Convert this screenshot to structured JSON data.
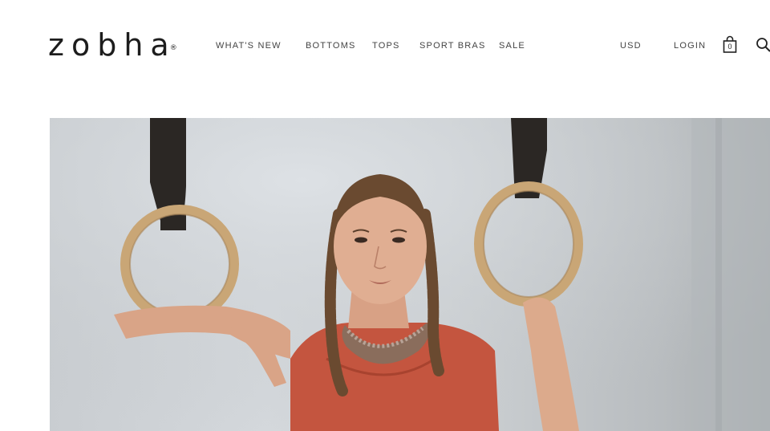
{
  "brand": {
    "name": "zobha",
    "mark": "®"
  },
  "nav": {
    "items": [
      {
        "label": "WHAT'S NEW"
      },
      {
        "label": "BOTTOMS"
      },
      {
        "label": "TOPS"
      },
      {
        "label": "SPORT BRAS"
      },
      {
        "label": "SALE"
      }
    ]
  },
  "utility": {
    "currency": "USD",
    "login": "LOGIN",
    "cart_count": "0",
    "icons": [
      "shopping-bag-icon",
      "search-icon"
    ]
  },
  "hero": {
    "image": "hero-image",
    "colors": {
      "backdrop": "#cdd1d4",
      "top": "#c4553f",
      "skin": "#e0ae92",
      "hair": "#6a4a30",
      "ring": "#c9a676",
      "strap": "#2b2724"
    }
  }
}
